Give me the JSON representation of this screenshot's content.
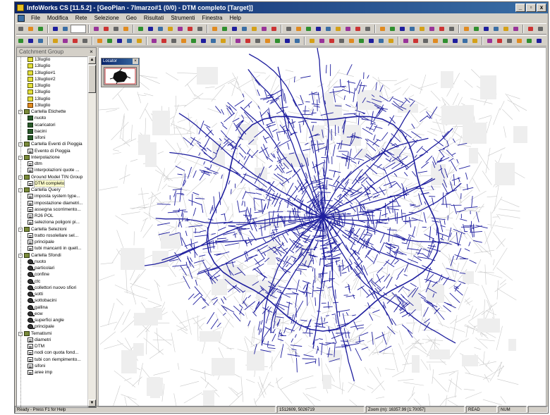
{
  "window": {
    "title": "InfoWorks CS [11.5.2] - [GeoPlan - 7Imarzo#1 (0/0) - DTM completo [Target]]",
    "controls": [
      "_",
      "▫",
      "x"
    ]
  },
  "menu": {
    "items": [
      "File",
      "Modifica",
      "Rete",
      "Selezione",
      "Geo",
      "Risultati",
      "Strumenti",
      "Finestra",
      "Help"
    ]
  },
  "panel": {
    "title": "Catchment Group",
    "tree": [
      {
        "level": 2,
        "icon": "sel",
        "label": "13luglio"
      },
      {
        "level": 2,
        "icon": "sel",
        "label": "13luglio"
      },
      {
        "level": 2,
        "icon": "sel",
        "label": "13luglio#1"
      },
      {
        "level": 2,
        "icon": "sel",
        "label": "13luglio#2"
      },
      {
        "level": 2,
        "icon": "sel",
        "label": "13luglio"
      },
      {
        "level": 2,
        "icon": "sel",
        "label": "13luglio"
      },
      {
        "level": 2,
        "icon": "sel",
        "label": "13luglio"
      },
      {
        "level": 2,
        "icon": "sel-orange",
        "label": "13luglio"
      },
      {
        "level": 1,
        "icon": "folder",
        "label": "Cartella Etichette",
        "expander": "-"
      },
      {
        "level": 2,
        "icon": "label",
        "label": "nuoto"
      },
      {
        "level": 2,
        "icon": "label",
        "label": "scaricatori"
      },
      {
        "level": 2,
        "icon": "label",
        "label": "bacini"
      },
      {
        "level": 2,
        "icon": "label",
        "label": "sifoni"
      },
      {
        "level": 1,
        "icon": "folder",
        "label": "Cartella Eventi di Pioggia",
        "expander": "-"
      },
      {
        "level": 2,
        "icon": "doc",
        "label": "Evento di Pioggia"
      },
      {
        "level": 1,
        "icon": "folder",
        "label": "Interpolazione",
        "expander": "-"
      },
      {
        "level": 2,
        "icon": "doc",
        "label": "dtm"
      },
      {
        "level": 2,
        "icon": "doc",
        "label": "interpolazioni quote ..."
      },
      {
        "level": 1,
        "icon": "folder",
        "label": "Ground Model TIN Group",
        "expander": "-"
      },
      {
        "level": 2,
        "icon": "doc",
        "label": "DTM completo",
        "selected": true
      },
      {
        "level": 1,
        "icon": "folder",
        "label": "Cartella Query",
        "expander": "-"
      },
      {
        "level": 2,
        "icon": "doc",
        "label": "imposta system type..."
      },
      {
        "level": 2,
        "icon": "doc",
        "label": "impostazione diametri..."
      },
      {
        "level": 2,
        "icon": "doc",
        "label": "assegna scorrimento..."
      },
      {
        "level": 2,
        "icon": "doc",
        "label": "R26 POL"
      },
      {
        "level": 2,
        "icon": "doc",
        "label": "seleziona poligoni pi..."
      },
      {
        "level": 1,
        "icon": "folder",
        "label": "Cartella Selezioni",
        "expander": "-"
      },
      {
        "level": 2,
        "icon": "doc",
        "label": "tratto rosolellare sel..."
      },
      {
        "level": 2,
        "icon": "doc",
        "label": "principale"
      },
      {
        "level": 2,
        "icon": "doc",
        "label": "tubi mancanti in quell..."
      },
      {
        "level": 1,
        "icon": "folder",
        "label": "Cartella Sfondi",
        "expander": "-"
      },
      {
        "level": 2,
        "icon": "theme",
        "label": "nuoto"
      },
      {
        "level": 2,
        "icon": "theme",
        "label": "particolari"
      },
      {
        "level": 2,
        "icon": "theme",
        "label": "confine"
      },
      {
        "level": 2,
        "icon": "theme",
        "label": "ctc"
      },
      {
        "level": 2,
        "icon": "theme",
        "label": "collettori nuovo sfiori"
      },
      {
        "level": 2,
        "icon": "theme",
        "label": "sotti"
      },
      {
        "level": 2,
        "icon": "theme",
        "label": "sottobacini"
      },
      {
        "level": 2,
        "icon": "theme",
        "label": "gallina"
      },
      {
        "level": 2,
        "icon": "theme",
        "label": "ecw"
      },
      {
        "level": 2,
        "icon": "theme",
        "label": "superfici angle"
      },
      {
        "level": 2,
        "icon": "theme",
        "label": "principale"
      },
      {
        "level": 1,
        "icon": "folder",
        "label": "Tematismi",
        "expander": "-"
      },
      {
        "level": 2,
        "icon": "doc",
        "label": "diametri"
      },
      {
        "level": 2,
        "icon": "doc",
        "label": "DTM"
      },
      {
        "level": 2,
        "icon": "doc",
        "label": "nodi con quota fond..."
      },
      {
        "level": 2,
        "icon": "doc",
        "label": "tubi con riempimento..."
      },
      {
        "level": 2,
        "icon": "doc",
        "label": "sifoni"
      },
      {
        "level": 2,
        "icon": "doc",
        "label": "aree imp"
      }
    ]
  },
  "locator": {
    "title": "Locator"
  },
  "map": {
    "network_color": "#1e1e9e",
    "background_line_color": "#c9c9c9"
  },
  "status": {
    "help_text": "Ready - Press F1 for Help",
    "coordinates": "1512609, 5026719",
    "zoom": "Zoom (m): 16357.99 [1:70057]",
    "mode": "READ",
    "num": "NUM"
  },
  "toolbar_colors": [
    "#3a6ea5",
    "#cc3333",
    "#2f8f2f",
    "#d4a017",
    "#666666",
    "#1e1e9e",
    "#993399",
    "#e08a20"
  ]
}
